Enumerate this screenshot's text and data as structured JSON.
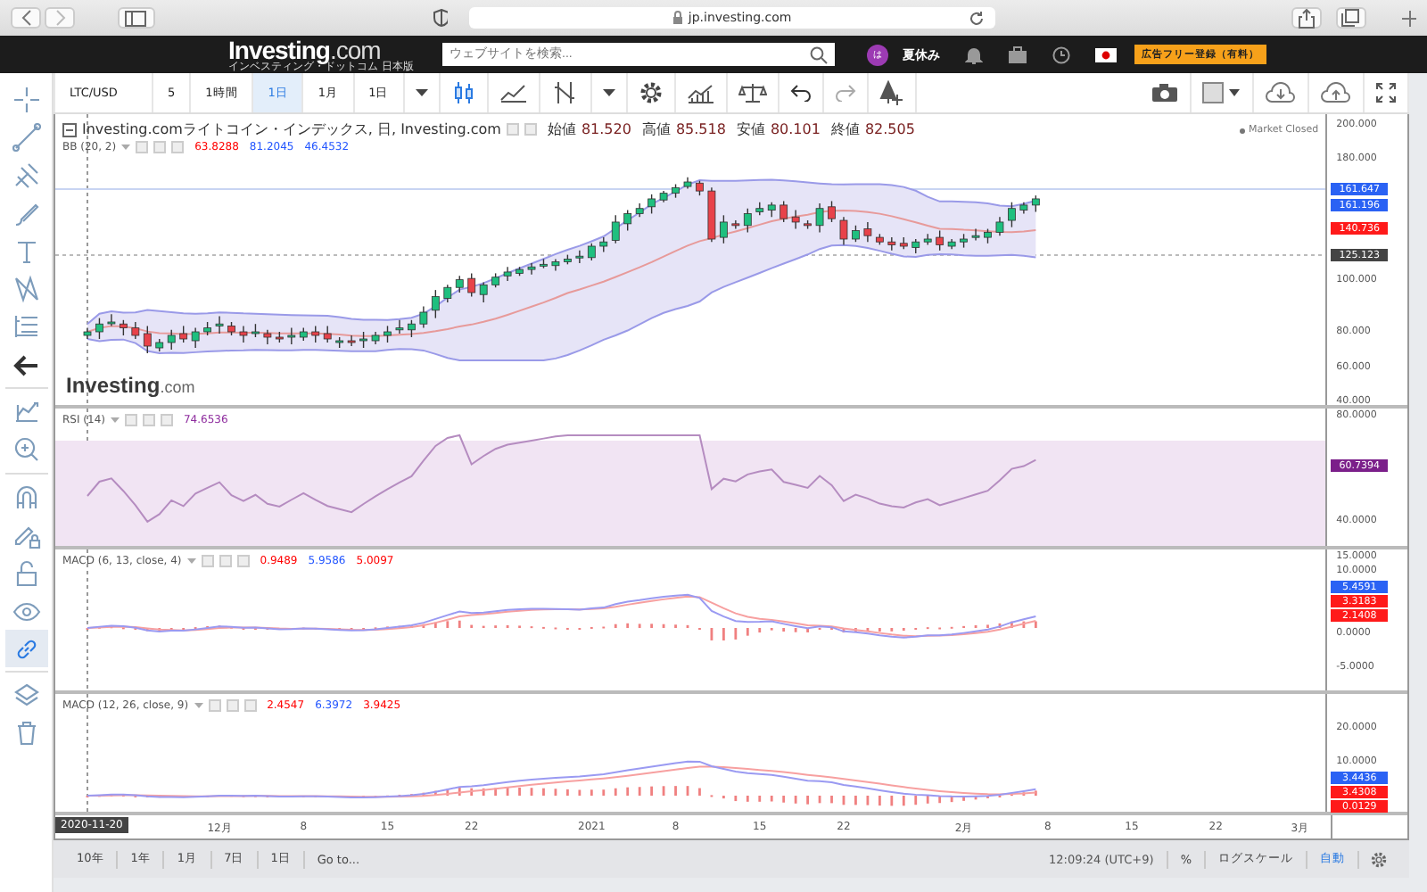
{
  "browser": {
    "address": "jp.investing.com"
  },
  "site_header": {
    "logo": "Investing",
    "logo_suffix": ".com",
    "tagline": "インベスティング・ドットコム 日本版",
    "search_placeholder": "ウェブサイトを検索...",
    "avatar_initial": "は",
    "user_name": "夏休み",
    "promo_button": "広告フリー登録（有料）"
  },
  "drawing_tools": [
    {
      "selected": false
    },
    {
      "selected": false
    },
    {
      "selected": false
    },
    {
      "selected": false
    },
    {
      "selected": false
    },
    {
      "selected": false
    },
    {
      "selected": false
    },
    {
      "selected": false
    },
    {
      "selected": false
    },
    {
      "selected": false
    },
    {
      "selected": false
    },
    {
      "selected": false
    },
    {
      "selected": false
    },
    {
      "selected": false
    },
    {
      "selected": true
    },
    {
      "selected": false
    },
    {
      "selected": false
    }
  ],
  "toolbar": {
    "symbol": "LTC/USD",
    "intervals": [
      {
        "label": "5",
        "selected": false
      },
      {
        "label": "1時間",
        "selected": false
      },
      {
        "label": "1日",
        "selected": true
      },
      {
        "label": "1月",
        "selected": false
      }
    ],
    "range": "1日"
  },
  "chart": {
    "title": "Investing.comライトコイン・インデックス, 日, Investing.com",
    "ohlc": [
      {
        "label": "始値",
        "value": "81.520"
      },
      {
        "label": "高値",
        "value": "85.518"
      },
      {
        "label": "安値",
        "value": "80.101"
      },
      {
        "label": "終値",
        "value": "82.505"
      }
    ],
    "market_status": "Market Closed",
    "watermark": "Investing",
    "watermark_suffix": ".com",
    "panes": [
      {
        "kind": "price",
        "legend": "BB (20, 2)",
        "values": [
          {
            "text": "63.8288",
            "color": "#ff0000"
          },
          {
            "text": "81.2045",
            "color": "#2255ff"
          },
          {
            "text": "46.4532",
            "color": "#2255ff"
          }
        ],
        "ticks": [
          "200.000",
          "180.000",
          "100.000",
          "80.000",
          "60.000",
          "40.000"
        ],
        "badges": [
          {
            "text": "161.647",
            "color": "#2a62f4"
          },
          {
            "text": "161.196",
            "color": "#2a62f4"
          },
          {
            "text": "140.736",
            "color": "#ff1a1a"
          },
          {
            "text": "125.123",
            "color": "#444444"
          }
        ]
      },
      {
        "kind": "rsi",
        "legend": "RSI (14)",
        "values": [
          {
            "text": "74.6536",
            "color": "#8e2c9e"
          }
        ],
        "ticks": [
          "80.0000",
          "40.0000"
        ],
        "badges": [
          {
            "text": "60.7394",
            "color": "#7b1f8a"
          }
        ]
      },
      {
        "kind": "macd",
        "legend": "MACD (6, 13, close, 4)",
        "values": [
          {
            "text": "0.9489",
            "color": "#ff0000"
          },
          {
            "text": "5.9586",
            "color": "#2255ff"
          },
          {
            "text": "5.0097",
            "color": "#ff0000"
          }
        ],
        "ticks": [
          "15.0000",
          "10.0000",
          "0.0000",
          "-5.0000"
        ],
        "badges": [
          {
            "text": "5.4591",
            "color": "#2a62f4"
          },
          {
            "text": "3.3183",
            "color": "#ff1a1a"
          },
          {
            "text": "2.1408",
            "color": "#ff1a1a"
          }
        ]
      },
      {
        "kind": "macd",
        "legend": "MACD (12, 26, close, 9)",
        "values": [
          {
            "text": "2.4547",
            "color": "#ff0000"
          },
          {
            "text": "6.3972",
            "color": "#2255ff"
          },
          {
            "text": "3.9425",
            "color": "#ff0000"
          }
        ],
        "ticks": [
          "20.0000",
          "10.0000"
        ],
        "badges": [
          {
            "text": "3.4436",
            "color": "#2a62f4"
          },
          {
            "text": "3.4308",
            "color": "#ff1a1a"
          },
          {
            "text": "0.0129",
            "color": "#ff1a1a"
          }
        ]
      }
    ],
    "x_axis": {
      "cursor_label": "2020-11-20",
      "labels": [
        "12月",
        "8",
        "15",
        "22",
        "2021",
        "8",
        "15",
        "22",
        "2月",
        "8",
        "15",
        "22",
        "3月"
      ]
    }
  },
  "bottom_bar": {
    "ranges": [
      "10年",
      "1年",
      "1月",
      "7日",
      "1日"
    ],
    "goto": "Go to...",
    "time": "12:09:24 (UTC+9)",
    "options": [
      {
        "text": "%",
        "selected": false
      },
      {
        "text": "ログスケール",
        "selected": false
      },
      {
        "text": "自動",
        "selected": true
      }
    ]
  }
}
